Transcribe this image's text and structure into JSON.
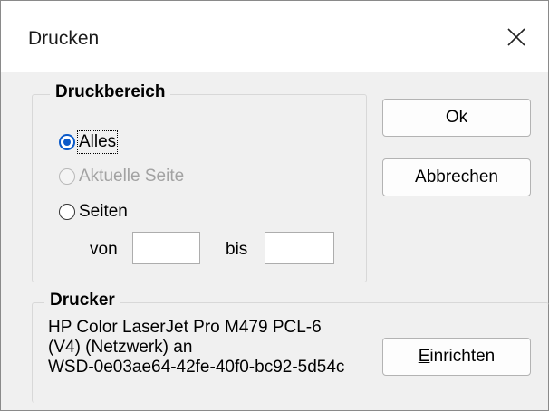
{
  "window": {
    "title": "Drucken",
    "close_icon": "close-icon"
  },
  "print_range": {
    "legend": "Druckbereich",
    "options": [
      {
        "label": "Alles",
        "checked": true,
        "enabled": true
      },
      {
        "label": "Aktuelle Seite",
        "checked": false,
        "enabled": false
      },
      {
        "label": "Seiten",
        "checked": false,
        "enabled": true
      }
    ],
    "from_label": "von",
    "from_value": "",
    "to_label": "bis",
    "to_value": ""
  },
  "buttons": {
    "ok": "Ok",
    "cancel": "Abbrechen",
    "setup_mnemonic": "E",
    "setup_rest": "inrichten"
  },
  "printer": {
    "legend": "Drucker",
    "lines": [
      "HP Color LaserJet Pro M479 PCL-6",
      "(V4) (Netzwerk) an",
      "WSD-0e03ae64-42fe-40f0-bc92-5d54c"
    ]
  },
  "colors": {
    "accent": "#0a59c9",
    "dialog_bg": "#f0f0f0"
  }
}
